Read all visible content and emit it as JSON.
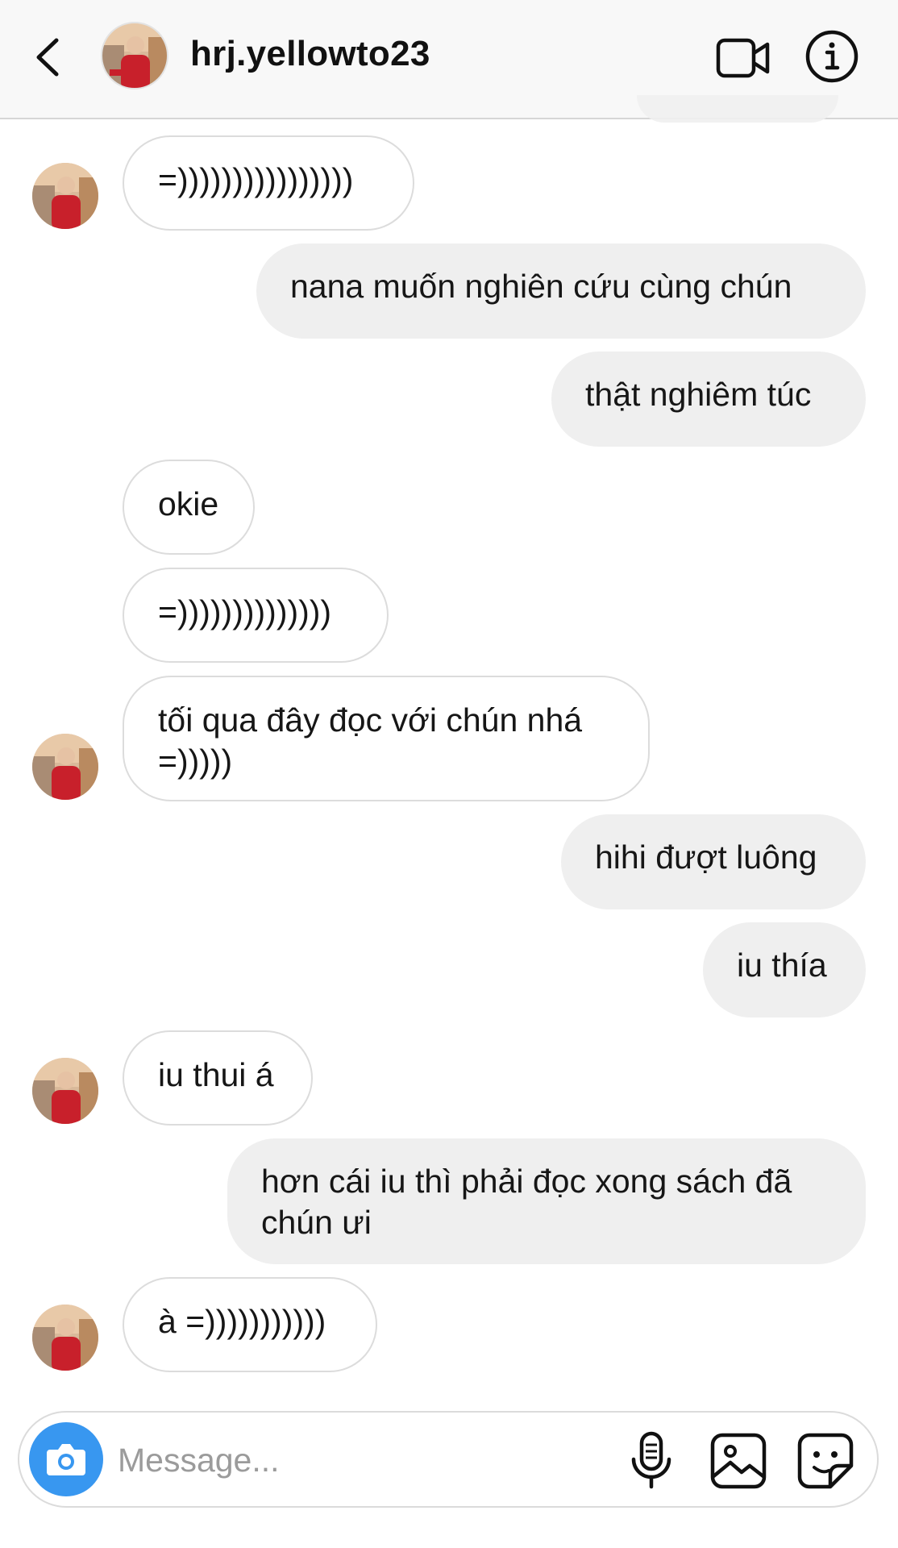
{
  "header": {
    "username": "hrj.yellowto23",
    "icons": [
      "back-icon",
      "avatar",
      "video-call-icon",
      "info-icon"
    ]
  },
  "messages": [
    {
      "from": "them",
      "text": "=))))))))))))))))",
      "avatar": true
    },
    {
      "from": "me",
      "text": "nana muốn nghiên cứu cùng chún"
    },
    {
      "from": "me",
      "text": "thật nghiêm túc"
    },
    {
      "from": "them",
      "text": "okie"
    },
    {
      "from": "them",
      "text": "=))))))))))))))"
    },
    {
      "from": "them",
      "text": "tối qua đây đọc với chún nhá =)))))",
      "avatar": true
    },
    {
      "from": "me",
      "text": "hihi đượt luông"
    },
    {
      "from": "me",
      "text": "iu thía"
    },
    {
      "from": "them",
      "text": "iu thui á",
      "avatar": true
    },
    {
      "from": "me",
      "text": "hơn cái iu thì phải đọc xong sách đã chún ưi"
    },
    {
      "from": "them",
      "text": "à =)))))))))))",
      "avatar": true
    }
  ],
  "composer": {
    "placeholder": "Message...",
    "icons": [
      "camera-icon",
      "microphone-icon",
      "gallery-icon",
      "sticker-icon"
    ]
  },
  "colors": {
    "header_bg": "#f8f8f8",
    "outgoing_bubble": "#efefef",
    "incoming_border": "#dcdcdc",
    "camera_button": "#3897f0",
    "placeholder": "#9b9b9b"
  }
}
